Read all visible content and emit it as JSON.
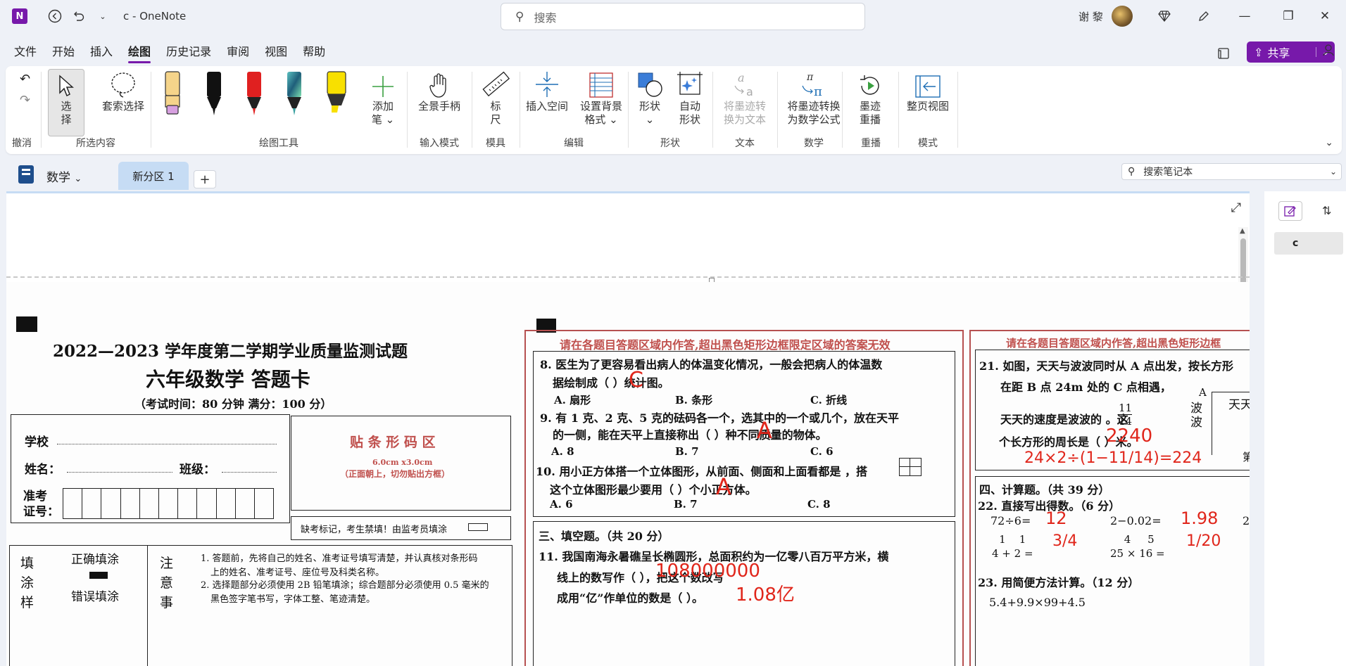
{
  "titlebar": {
    "logo": "N",
    "title": "c  -  OneNote",
    "search_placeholder": "搜索",
    "user_name": "谢 黎"
  },
  "menu": {
    "tabs": [
      "文件",
      "开始",
      "插入",
      "绘图",
      "历史记录",
      "审阅",
      "视图",
      "帮助"
    ],
    "active": "绘图",
    "share_label": "共享"
  },
  "ribbon": {
    "groups": {
      "undo": "撤消",
      "selection": "所选内容",
      "draw_tools": "绘图工具",
      "input_mode": "输入模式",
      "ruler_group": "模具",
      "edit": "编辑",
      "shapes": "形状",
      "text": "文本",
      "math": "数学",
      "replay": "重播",
      "mode": "模式"
    },
    "buttons": {
      "select": "选\n择",
      "lasso": "套索选择",
      "add_pen": "添加\n笔 ⌄",
      "pan": "全景手柄",
      "ruler": "标\n尺",
      "insert_space": "插入空间",
      "bg_format": "设置背景\n格式 ⌄",
      "shapes": "形状\n⌄",
      "autoshape": "自动\n形状",
      "ink_to_text": "将墨迹转\n换为文本",
      "ink_to_math": "将墨迹转换\n为数学公式",
      "ink_replay": "墨迹\n重播",
      "full_page": "整页视图"
    },
    "pen_colors": [
      "#f5d48a",
      "#111111",
      "#e02020",
      "#3aa0a0",
      "#f8e000"
    ]
  },
  "notebook": {
    "name": "数学",
    "section": "新分区 1",
    "add_label": "+",
    "search_placeholder": "搜索笔记本"
  },
  "pages": [
    "c"
  ],
  "paper": {
    "title": "2022—2023 学年度第二学期学业质量监测试题",
    "subtitle": "六年级数学  答题卡",
    "exam_info": "（考试时间：80 分钟    满分：100 分）",
    "school": "学校",
    "name": "姓名：",
    "class": "班级：",
    "exam_no": "准考\n证号：",
    "barcode_title": "贴 条 形 码 区",
    "barcode_size": "6.0cm x3.0cm",
    "barcode_note": "（正面朝上，切勿贴出方框）",
    "absent": "缺考标记，考生禁填！由监考员填涂",
    "fill": "填\n涂\n样",
    "correct_fill": "正确填涂",
    "wrong_fill": "错误填涂",
    "notice": "注\n意\n事",
    "notice_1": "1. 答题前，先将自己的姓名、准考证号填写清楚，并认真核对条形码",
    "notice_1b": "上的姓名、准考证号、座位号及科类名称。",
    "notice_2": "2. 选择题部分必须使用 2B 铅笔填涂；综合题部分必须使用 0.5 毫米的",
    "notice_2b": "黑色签字笔书写，字体工整、笔迹清楚。",
    "warning": "请在各题目答题区域内作答,超出黑色矩形边框限定区域的答案无效",
    "warning_short": "请在各题目答题区域内作答,超出黑色矩形边框",
    "q8": "8. 医生为了更容易看出病人的体温变化情况，一般会把病人的体温数",
    "q8b": "据绘制成（      ）统计图。",
    "q8_opts": [
      "A. 扇形",
      "B. 条形",
      "C. 折线"
    ],
    "q9": "9. 有 1 克、2 克、5 克的砝码各一个，选其中的一个或几个，放在天平",
    "q9b": "的一侧，能在天平上直接称出（      ）种不同质量的物体。",
    "q9_opts": [
      "A. 8",
      "B. 7",
      "C. 6"
    ],
    "q10": "10. 用小正方体搭一个立体图形，从前面、侧面和上面看都是     ，搭",
    "q10b": "这个立体图形最少要用（      ）个小正方体。",
    "q10_opts": [
      "A. 6",
      "B. 7",
      "C. 8"
    ],
    "sec3": "三、填空题。（共 20 分）",
    "q11": "11. 我国南海永暑礁呈长椭圆形，总面积约为一亿零八百万平方米，横",
    "q11b": "线上的数写作（                          ），把这个数改写",
    "q11c": "成用“亿”作单位的数是（               ）。",
    "q21": "21. 如图，天天与波波同时从 A 点出发，按长方形",
    "q21b": "在距 B 点 24m 处的 C 点相遇，",
    "q21c": "天天的速度是波波的      。这",
    "q21d": "个长方形的周长是（          ）米。",
    "frac_11_14": [
      "11",
      "14"
    ],
    "fig_A": "A",
    "fig_tiantian": "天天",
    "fig_bobo": "波\n波",
    "fig_di": "第",
    "sec4": "四、计算题。（共 39 分）",
    "q22": "22. 直接写出得数。（6 分）",
    "calc1": "72÷6=",
    "calc2": "2−0.02=",
    "calc3": "2.",
    "q23": "23. 用简便方法计算。（12 分）",
    "q23a": "5.4+9.9×99+4.5",
    "handwriting": {
      "q8": "C",
      "q9": "A",
      "q10": "A",
      "q11": "108000000",
      "q11b": "1.08亿",
      "q21": "2240",
      "q21_work": "24×2÷(1−11/14)=224",
      "c1": "12",
      "c2": "1.98",
      "c3": "3/4",
      "c4": "1/20"
    }
  }
}
